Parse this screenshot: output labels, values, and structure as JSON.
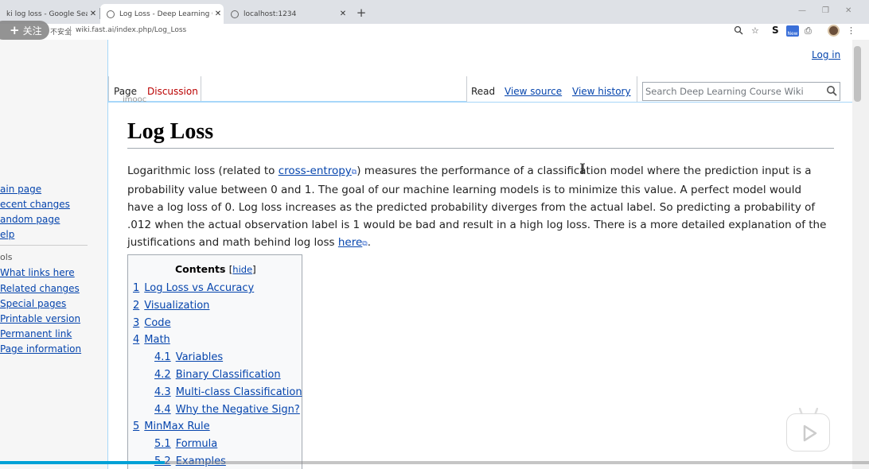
{
  "browser": {
    "tabs": [
      {
        "title": "ki log loss - Google Search",
        "active": false
      },
      {
        "title": "Log Loss - Deep Learning Cou",
        "active": true
      },
      {
        "title": "localhost:1234",
        "active": false
      }
    ],
    "security_label": "不安全",
    "url": "wiki.fast.ai/index.php/Log_Loss",
    "follow_label": "关注",
    "ext_s_label": "S",
    "ext_new_label": "New"
  },
  "wiki": {
    "login_label": "Log in",
    "tab_page": "Page",
    "tab_discussion": "Discussion",
    "view_read": "Read",
    "view_source": "View source",
    "view_history": "View history",
    "search_placeholder": "Search Deep Learning Course Wiki",
    "watermark": "imooc",
    "nav": [
      "ain page",
      "ecent changes",
      "andom page",
      "elp"
    ],
    "tools_heading": "ols",
    "tools": [
      "What links here",
      "Related changes",
      "Special pages",
      "Printable version",
      "Permanent link",
      "Page information"
    ],
    "title": "Log Loss",
    "intro": {
      "before_link": "Logarithmic loss (related to ",
      "link1": "cross-entropy",
      "middle": ") measures the performance of a classification model where the prediction input is a probability value between 0 and 1. The goal of our machine learning models is to minimize this value. A perfect model would have a log loss of 0. Log loss increases as the predicted probability diverges from the actual label. So predicting a probability of .012 when the actual observation label is 1 would be bad and result in a high log loss. There is a more detailed explanation of the justifications and math behind log loss ",
      "link2": "here",
      "end": "."
    },
    "toc": {
      "title": "Contents",
      "hide_label": "hide",
      "items": [
        {
          "num": "1",
          "label": "Log Loss vs Accuracy",
          "level": 1
        },
        {
          "num": "2",
          "label": "Visualization",
          "level": 1
        },
        {
          "num": "3",
          "label": "Code",
          "level": 1
        },
        {
          "num": "4",
          "label": "Math",
          "level": 1
        },
        {
          "num": "4.1",
          "label": "Variables",
          "level": 2
        },
        {
          "num": "4.2",
          "label": "Binary Classification",
          "level": 2
        },
        {
          "num": "4.3",
          "label": "Multi-class Classification",
          "level": 2
        },
        {
          "num": "4.4",
          "label": "Why the Negative Sign?",
          "level": 2
        },
        {
          "num": "5",
          "label": "MinMax Rule",
          "level": 1
        },
        {
          "num": "5.1",
          "label": "Formula",
          "level": 2
        },
        {
          "num": "5.2",
          "label": "Examples",
          "level": 2
        }
      ]
    }
  },
  "video": {
    "progress": 0.19
  },
  "colors": {
    "link": "#0645ad",
    "new_link": "#ba0000",
    "progress": "#00a1d6"
  }
}
